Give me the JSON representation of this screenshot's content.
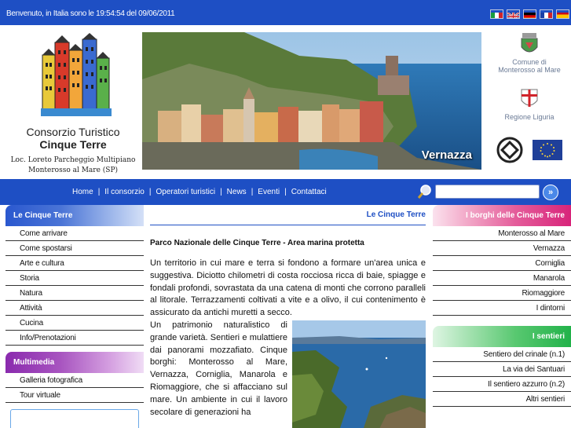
{
  "topbar": {
    "greeting": "Benvenuto, in Italia sono le 19:54:54 del 09/06/2011",
    "flags": [
      {
        "name": "italian",
        "colors": [
          "#1a9c3e",
          "#ffffff",
          "#d0232a"
        ]
      },
      {
        "name": "english",
        "colors": [
          "#1f3f99",
          "#ffffff",
          "#d0232a"
        ]
      },
      {
        "name": "german",
        "colors": [
          "#000000",
          "#dd0000",
          "#ffce00"
        ]
      },
      {
        "name": "french",
        "colors": [
          "#1a3ea6",
          "#ffffff",
          "#d0232a"
        ]
      },
      {
        "name": "spanish",
        "colors": [
          "#c60b1e",
          "#ffc400",
          "#c60b1e"
        ]
      }
    ]
  },
  "logo": {
    "name_line1": "Consorzio Turistico",
    "name_line2": "Cinque Terre",
    "address_line1": "Loc. Loreto Parcheggio Multipiano",
    "address_line2": "Monterosso al Mare (SP)"
  },
  "hero": {
    "caption": "Vernazza"
  },
  "partners": {
    "comune_line1": "Comune di",
    "comune_line2": "Monterosso al Mare",
    "regione": "Regione Liguria"
  },
  "nav": {
    "items": [
      "Home",
      "Il consorzio",
      "Operatori turistici",
      "News",
      "Eventi",
      "Contattaci"
    ],
    "separator": "|"
  },
  "search": {
    "value": "",
    "button_glyph": "»"
  },
  "left_menu": {
    "title": "Le Cinque Terre",
    "items": [
      "Come arrivare",
      "Come spostarsi",
      "Arte e cultura",
      "Storia",
      "Natura",
      "Attività",
      "Cucina",
      "Info/Prenotazioni"
    ],
    "multimedia_title": "Multimedia",
    "multimedia_items": [
      "Galleria fotografica",
      "Tour virtuale"
    ]
  },
  "main": {
    "breadcrumb": "Le Cinque Terre",
    "heading": "Parco Nazionale delle Cinque Terre - Area marina protetta",
    "paragraph1": "Un territorio in cui mare e terra si fondono a formare un'area unica e suggestiva. Diciotto chilometri di costa rocciosa ricca di baie, spiagge e fondali profondi, sovrastata da una catena di monti che corrono paralleli al litorale. Terrazzamenti coltivati a vite e a olivo, il cui contenimento è assicurato da antichi muretti a secco.",
    "paragraph2": "Un patrimonio naturalistico di grande varietà. Sentieri e mulattiere dai panorami mozzafiato. Cinque borghi: Monterosso al Mare, Vernazza, Corniglia, Manarola e Riomaggiore, che si affacciano sul mare. Un ambiente in cui il lavoro secolare di generazioni ha"
  },
  "right_menu": {
    "borghi_title": "I borghi delle Cinque Terre",
    "borghi_items": [
      "Monterosso al Mare",
      "Vernazza",
      "Corniglia",
      "Manarola",
      "Riomaggiore",
      "I dintorni"
    ],
    "sentieri_title": "I sentieri",
    "sentieri_items": [
      "Sentiero del crinale (n.1)",
      "La via dei Santuari",
      "Il sentiero azzurro (n.2)",
      "Altri sentieri"
    ]
  },
  "colors": {
    "brand_blue": "#1e4fc4",
    "menu_blue": "#2a58cf",
    "menu_purple": "#8a2aae",
    "menu_pink": "#d8247a",
    "menu_green": "#22b24a"
  }
}
